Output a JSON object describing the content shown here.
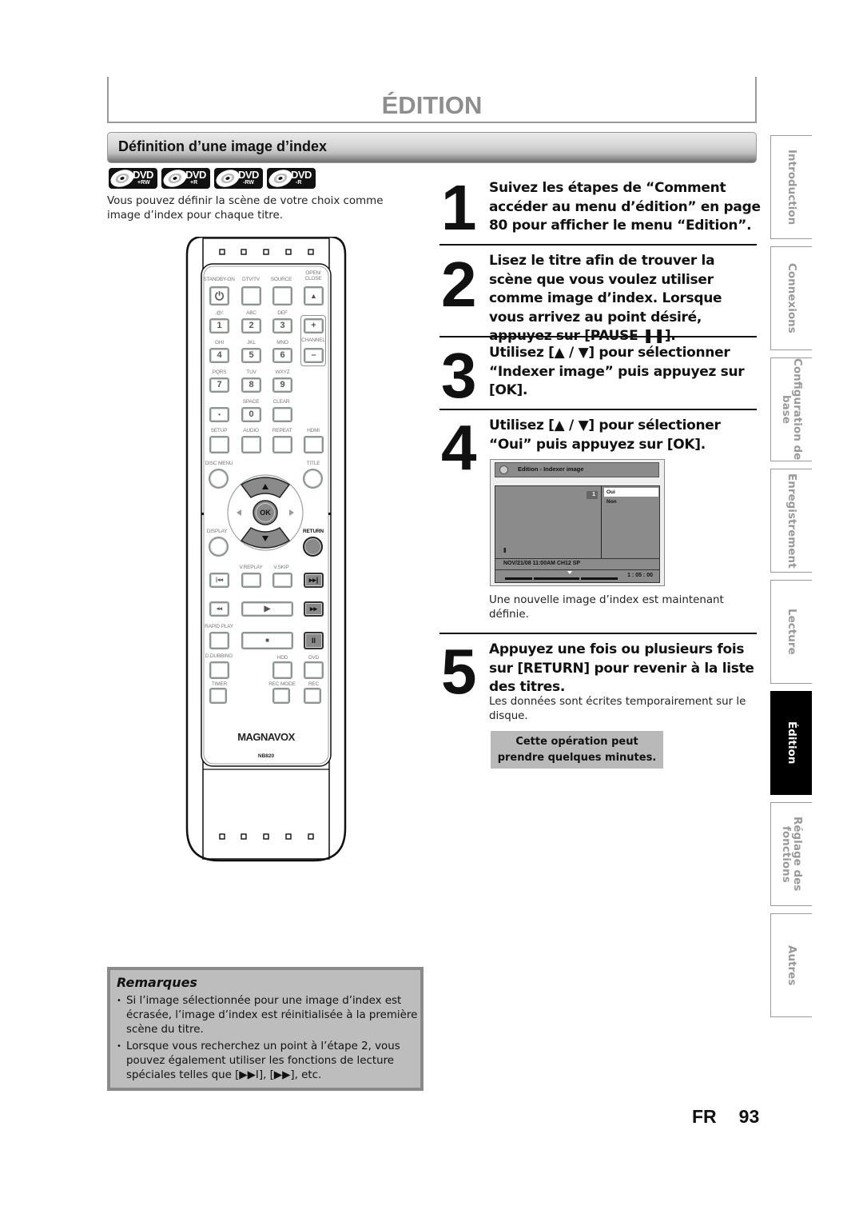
{
  "header": {
    "chapter_title": "ÉDITION",
    "section_title": "Définition d’une image d’index"
  },
  "disc_types": [
    {
      "label": "DVD",
      "sub": "+RW",
      "icon": "dvd-plus-rw-logo"
    },
    {
      "label": "DVD",
      "sub": "+R",
      "icon": "dvd-plus-r-logo"
    },
    {
      "label": "DVD",
      "sub": "-RW",
      "icon": "dvd-minus-rw-logo"
    },
    {
      "label": "DVD",
      "sub": "-R",
      "icon": "dvd-minus-r-logo"
    }
  ],
  "intro": "Vous pouvez définir la scène de votre choix comme image d’index pour chaque titre.",
  "remote": {
    "brand": "MAGNAVOX",
    "model": "NB820",
    "labels": {
      "standby": "STANDBY-ON",
      "dtvtv": "DTV/TV",
      "source": "SOURCE",
      "open_close": "OPEN/\nCLOSE",
      "k1": ".@/:",
      "k2": "ABC",
      "k3": "DEF",
      "k4": "GHI",
      "k5": "JKL",
      "k6": "MNO",
      "k7": "PQRS",
      "k8": "TUV",
      "k9": "WXYZ",
      "channel": "CHANNEL",
      "space": "SPACE",
      "clear": "CLEAR",
      "setup": "SETUP",
      "audio": "AUDIO",
      "repeat": "REPEAT",
      "hdmi": "HDMI",
      "disc_menu": "DISC MENU",
      "title": "TITLE",
      "ok": "OK",
      "display": "DISPLAY",
      "return": "RETURN",
      "vreplay": "V.REPLAY",
      "vskip": "V.SKIP",
      "rapid_play": "RAPID PLAY",
      "ddubbing": "D.DUBBING",
      "hdd": "HDD",
      "dvd": "DVD",
      "timer": "TIMER",
      "rec_mode": "REC MODE",
      "rec": "REC"
    },
    "keys": {
      "k1": "1",
      "k2": "2",
      "k3": "3",
      "k4": "4",
      "k5": "5",
      "k6": "6",
      "k7": "7",
      "k8": "8",
      "k9": "9",
      "k0": "0",
      "dot": "•",
      "ch_up": "+",
      "ch_down": "–",
      "eject": "▲",
      "prev": "|◂◂",
      "next": "▸▸|",
      "rew": "◂◂",
      "ff": "▸▸",
      "play": "▶",
      "stop": "■",
      "pause": "II"
    }
  },
  "steps": [
    {
      "num": "1",
      "text": "Suivez les étapes de “Comment accéder au menu d’édition” en page 80 pour afficher le menu “Edition”."
    },
    {
      "num": "2",
      "text": "Lisez le titre afin de trouver la scène que vous voulez utiliser comme image d’index. Lorsque vous arrivez au point désiré, appuyez sur [PAUSE ❚❚]."
    },
    {
      "num": "3",
      "text": "Utilisez [▲ / ▼] pour sélectionner “Indexer image” puis appuyez sur [OK]."
    },
    {
      "num": "4",
      "text": "Utilisez [▲ / ▼] pour sélectioner “Oui” puis appuyez sur [OK].",
      "note": "Une nouvelle image d’index est maintenant définie."
    },
    {
      "num": "5",
      "text": "Appuyez une fois ou plusieurs fois sur [RETURN] pour revenir à la liste des titres.",
      "note": "Les données sont écrites temporairement sur le disque."
    }
  ],
  "osd": {
    "title": "Edition - Indexer image",
    "title_number": "1",
    "options": [
      "Oui",
      "Non"
    ],
    "selected_option": "Oui",
    "status_icon": "II",
    "info": "NOV/21/08 11:00AM CH12 SP",
    "time": "1 : 05 : 00"
  },
  "notice": "Cette opération peut prendre quelques minutes.",
  "side_tabs": [
    {
      "label": "Introduction",
      "active": false
    },
    {
      "label": "Connexions",
      "active": false
    },
    {
      "label": "Configuration de\nbase",
      "active": false
    },
    {
      "label": "Enregistrement",
      "active": false
    },
    {
      "label": "Lecture",
      "active": false
    },
    {
      "label": "Édition",
      "active": true
    },
    {
      "label": "Réglage des\nfonctions",
      "active": false
    },
    {
      "label": "Autres",
      "active": false
    }
  ],
  "remarks": {
    "title": "Remarques",
    "items": [
      "Si l’image sélectionnée pour une image d’index est écrasée, l’image d’index est réinitialisée à la première scène du titre.",
      "Lorsque vous recherchez un point à l’étape 2, vous pouvez également utiliser les fonctions de lecture spéciales telles que [▶▶I], [▶▶], etc."
    ]
  },
  "footer": {
    "lang": "FR",
    "page": "93"
  }
}
